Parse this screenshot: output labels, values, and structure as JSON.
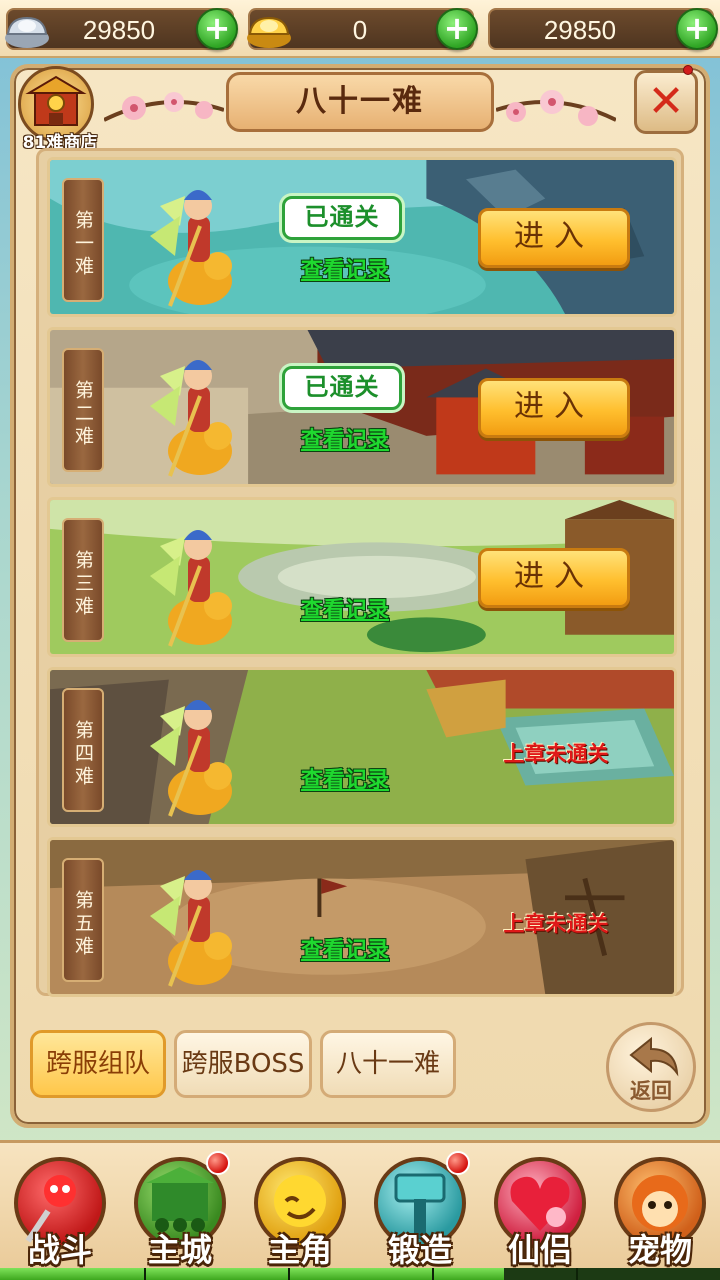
{
  "currencies": [
    {
      "name": "silver",
      "value": "29850"
    },
    {
      "name": "gold",
      "value": "0"
    },
    {
      "name": "other",
      "value": "29850"
    }
  ],
  "shop": {
    "label": "81难商店"
  },
  "panel_title": "八十一难",
  "levels": [
    {
      "tag": "第一难",
      "cleared_label": "已通关",
      "record_label": "查看记录",
      "enter_label": "进入",
      "status": "cleared"
    },
    {
      "tag": "第二难",
      "cleared_label": "已通关",
      "record_label": "查看记录",
      "enter_label": "进入",
      "status": "cleared"
    },
    {
      "tag": "第三难",
      "record_label": "查看记录",
      "enter_label": "进入",
      "status": "open"
    },
    {
      "tag": "第四难",
      "record_label": "查看记录",
      "locked_label": "上章未通关",
      "status": "locked"
    },
    {
      "tag": "第五难",
      "record_label": "查看记录",
      "locked_label": "上章未通关",
      "status": "locked"
    }
  ],
  "tabs": [
    {
      "label": "跨服组队",
      "active": true
    },
    {
      "label": "跨服BOSS",
      "active": false
    },
    {
      "label": "八十一难",
      "active": false
    }
  ],
  "back_label": "返回",
  "nav": [
    {
      "label": "战斗",
      "icon": "battle-icon",
      "badge": false
    },
    {
      "label": "主城",
      "icon": "city-icon",
      "badge": true
    },
    {
      "label": "主角",
      "icon": "hero-icon",
      "badge": false
    },
    {
      "label": "锻造",
      "icon": "forge-icon",
      "badge": true
    },
    {
      "label": "仙侣",
      "icon": "partner-icon",
      "badge": false
    },
    {
      "label": "宠物",
      "icon": "pet-icon",
      "badge": false
    }
  ],
  "progress": 0.7,
  "colors": {
    "accent_gold": "#ffbf2e",
    "cleared_green": "#1c8f2b",
    "record_green": "#1fd92f",
    "locked_red": "#e01818"
  }
}
